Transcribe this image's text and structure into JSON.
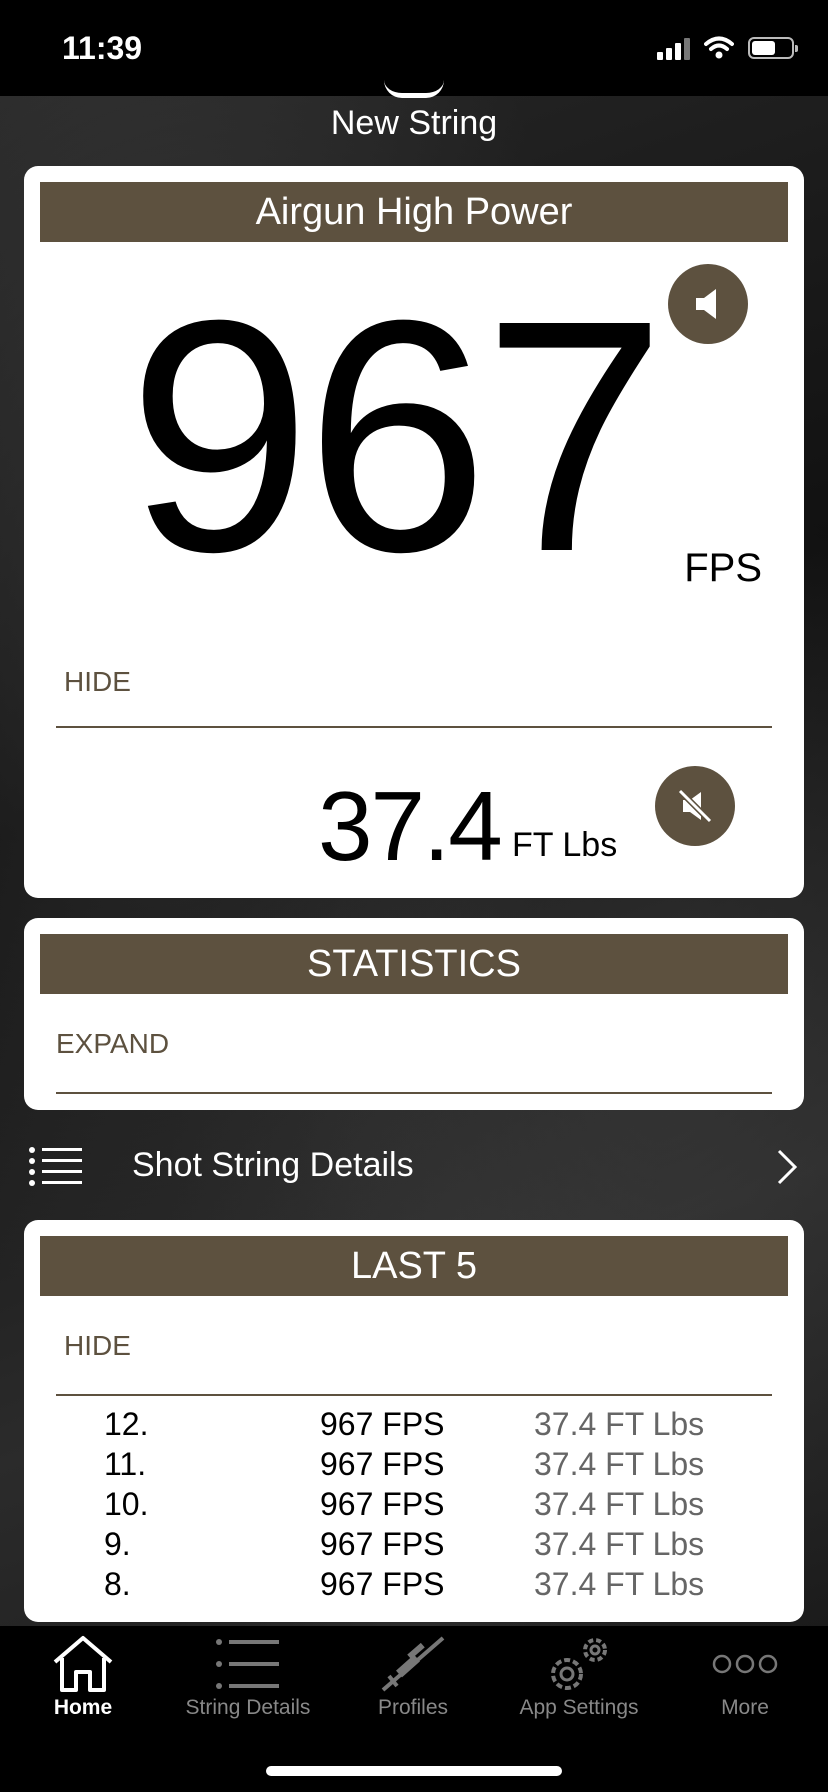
{
  "status_bar": {
    "time": "11:39"
  },
  "new_string": {
    "label": "New String"
  },
  "speed_card": {
    "title": "Airgun High Power",
    "speed_value": "967",
    "speed_unit": "FPS",
    "hide_label": "HIDE",
    "energy_value": "37.4",
    "energy_unit": "FT Lbs",
    "sound_icon": "speaker-icon",
    "mute_icon": "speaker-muted-icon"
  },
  "stats_card": {
    "title": "STATISTICS",
    "expand_label": "EXPAND"
  },
  "shot_string": {
    "label": "Shot String Details",
    "icon": "list-icon",
    "chevron": "chevron-right-icon"
  },
  "last_card": {
    "title": "LAST 5",
    "hide_label": "HIDE",
    "shots": [
      {
        "num": "12.",
        "fps": "967 FPS",
        "energy": "37.4 FT Lbs"
      },
      {
        "num": "11.",
        "fps": "967 FPS",
        "energy": "37.4 FT Lbs"
      },
      {
        "num": "10.",
        "fps": "967 FPS",
        "energy": "37.4 FT Lbs"
      },
      {
        "num": "9.",
        "fps": "967 FPS",
        "energy": "37.4 FT Lbs"
      },
      {
        "num": "8.",
        "fps": "967 FPS",
        "energy": "37.4 FT Lbs"
      }
    ]
  },
  "tabs": [
    {
      "label": "Home",
      "icon": "home-icon",
      "active": true
    },
    {
      "label": "String Details",
      "icon": "list-icon",
      "active": false
    },
    {
      "label": "Profiles",
      "icon": "rifle-icon",
      "active": false
    },
    {
      "label": "App Settings",
      "icon": "gears-icon",
      "active": false
    },
    {
      "label": "More",
      "icon": "more-icon",
      "active": false
    }
  ],
  "colors": {
    "accent": "#5d513f",
    "card": "#ffffff",
    "tab_bar": "#000000"
  }
}
